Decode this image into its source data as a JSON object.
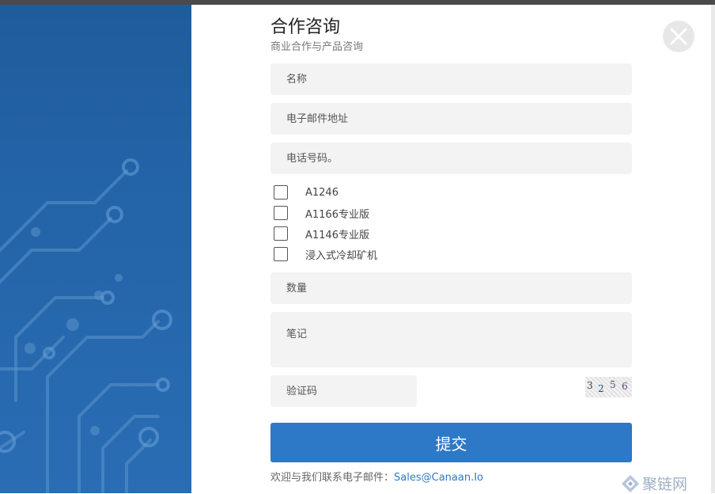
{
  "form": {
    "title": "合作咨询",
    "subtitle": "商业合作与产品咨询",
    "name_placeholder": "名称",
    "email_placeholder": "电子邮件地址",
    "phone_placeholder": "电话号码。",
    "products": [
      {
        "label": "A1246",
        "checked": false
      },
      {
        "label": "A1166专业版",
        "checked": false
      },
      {
        "label": "A1146专业版",
        "checked": false
      },
      {
        "label": "浸入式冷却矿机",
        "checked": false
      }
    ],
    "quantity_placeholder": "数量",
    "notes_placeholder": "笔记",
    "captcha_placeholder": "验证码",
    "captcha_chars": [
      "3",
      "2",
      "5",
      "6"
    ],
    "submit_label": "提交",
    "contact_prefix": "欢迎与我们联系电子邮件：",
    "contact_email": "Sales@Canaan.Io"
  },
  "icons": {
    "close": "close-icon",
    "watermark": "logo-icon"
  },
  "watermark_text": "聚链网",
  "colors": {
    "accent": "#2d78c7",
    "side_panel": "#2363a7",
    "field_bg": "#f3f3f3"
  }
}
